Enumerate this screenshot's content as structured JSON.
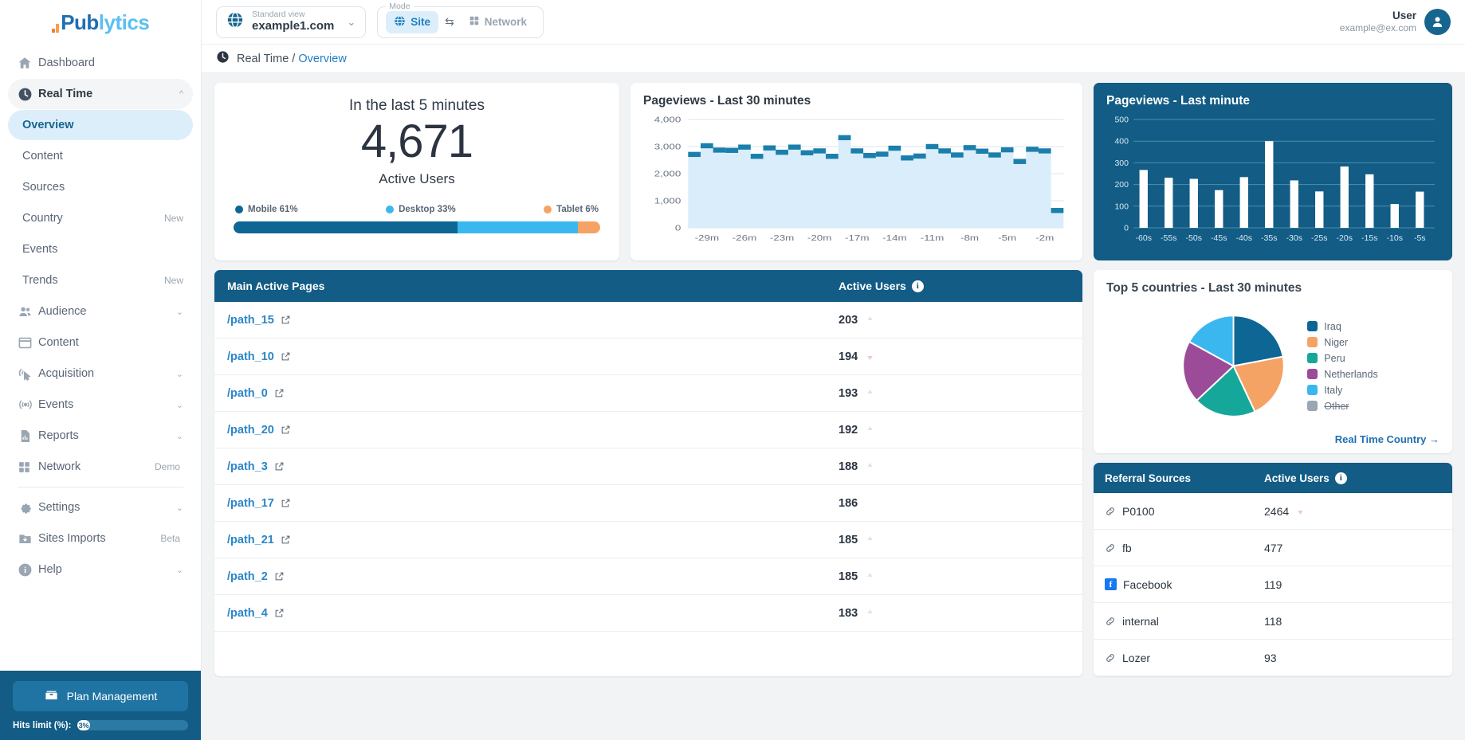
{
  "brand": {
    "name_part1": "Pub",
    "name_part2": "lytics"
  },
  "sidebar": {
    "items": [
      {
        "label": "Dashboard",
        "icon": "home-icon",
        "tag": "",
        "type": "item"
      },
      {
        "label": "Real Time",
        "icon": "clock-icon",
        "tag": "",
        "type": "parent-active"
      },
      {
        "label": "Overview",
        "tag": "",
        "type": "sub-selected"
      },
      {
        "label": "Content",
        "tag": "",
        "type": "sub"
      },
      {
        "label": "Sources",
        "tag": "",
        "type": "sub"
      },
      {
        "label": "Country",
        "tag": "New",
        "type": "sub"
      },
      {
        "label": "Events",
        "tag": "",
        "type": "sub"
      },
      {
        "label": "Trends",
        "tag": "New",
        "type": "sub"
      },
      {
        "label": "Audience",
        "icon": "people-icon",
        "tag": "",
        "type": "item-chev"
      },
      {
        "label": "Content",
        "icon": "window-icon",
        "tag": "",
        "type": "item"
      },
      {
        "label": "Acquisition",
        "icon": "click-icon",
        "tag": "",
        "type": "item-chev"
      },
      {
        "label": "Events",
        "icon": "broadcast-icon",
        "tag": "",
        "type": "item-chev"
      },
      {
        "label": "Reports",
        "icon": "report-icon",
        "tag": "",
        "type": "item-chev"
      },
      {
        "label": "Network",
        "icon": "grid-icon",
        "tag": "Demo",
        "type": "item"
      },
      {
        "label": "Settings",
        "icon": "gear-icon",
        "tag": "",
        "type": "item-chev"
      },
      {
        "label": "Sites Imports",
        "icon": "import-icon",
        "tag": "Beta",
        "type": "item"
      },
      {
        "label": "Help",
        "icon": "help-icon",
        "tag": "",
        "type": "item-chev"
      }
    ],
    "plan_button": "Plan Management",
    "hits_label": "Hits limit (%):",
    "hits_value": "3%",
    "hits_percent": 3
  },
  "topbar": {
    "view_label": "Standard view",
    "site": "example1.com",
    "mode_legend": "Mode",
    "mode_site": "Site",
    "mode_network": "Network",
    "user_name": "User",
    "user_email": "example@ex.com"
  },
  "breadcrumb": {
    "section": "Real Time / ",
    "current": "Overview"
  },
  "active_card": {
    "title": "In the last 5 minutes",
    "value": "4,671",
    "subtitle": "Active Users",
    "devices": [
      {
        "label": "Mobile 61%",
        "percent": 61,
        "color": "#0d6693"
      },
      {
        "label": "Desktop 33%",
        "percent": 33,
        "color": "#3bb7f0"
      },
      {
        "label": "Tablet 6%",
        "percent": 6,
        "color": "#f5a365"
      }
    ]
  },
  "tables": {
    "pages": {
      "header_col1": "Main Active Pages",
      "header_col2": "Active Users",
      "rows": [
        {
          "path": "/path_15",
          "users": "203",
          "trend": "up"
        },
        {
          "path": "/path_10",
          "users": "194",
          "trend": "down"
        },
        {
          "path": "/path_0",
          "users": "193",
          "trend": "up"
        },
        {
          "path": "/path_20",
          "users": "192",
          "trend": "up"
        },
        {
          "path": "/path_3",
          "users": "188",
          "trend": "up"
        },
        {
          "path": "/path_17",
          "users": "186",
          "trend": "none"
        },
        {
          "path": "/path_21",
          "users": "185",
          "trend": "up"
        },
        {
          "path": "/path_2",
          "users": "185",
          "trend": "up"
        },
        {
          "path": "/path_4",
          "users": "183",
          "trend": "up"
        }
      ]
    },
    "referral": {
      "header_col1": "Referral Sources",
      "header_col2": "Active Users",
      "rows": [
        {
          "name": "P0100",
          "users": "2464",
          "icon": "link-icon",
          "trend": "down"
        },
        {
          "name": "fb",
          "users": "477",
          "icon": "link-icon",
          "trend": "none"
        },
        {
          "name": "Facebook",
          "users": "119",
          "icon": "facebook-icon",
          "trend": "none"
        },
        {
          "name": "internal",
          "users": "118",
          "icon": "link-icon",
          "trend": "none"
        },
        {
          "name": "Lozer",
          "users": "93",
          "icon": "link-icon",
          "trend": "none"
        }
      ]
    }
  },
  "pie_card": {
    "title": "Top 5 countries - Last 30 minutes",
    "link": "Real Time Country",
    "link_arrow": "→"
  },
  "chart_data": [
    {
      "type": "area",
      "title": "Pageviews - Last 30 minutes",
      "xlabel": "",
      "ylabel": "",
      "ylim": [
        0,
        4000
      ],
      "yticks": [
        "0",
        "1,000",
        "2,000",
        "3,000",
        "4,000"
      ],
      "xticks": [
        "-29m",
        "-26m",
        "-23m",
        "-20m",
        "-17m",
        "-14m",
        "-11m",
        "-8m",
        "-5m",
        "-2m"
      ],
      "grid": true,
      "x": [
        "-30m",
        "-29m",
        "-28m",
        "-27m",
        "-26m",
        "-25m",
        "-24m",
        "-23m",
        "-22m",
        "-21m",
        "-20m",
        "-19m",
        "-18m",
        "-17m",
        "-16m",
        "-15m",
        "-14m",
        "-13m",
        "-12m",
        "-11m",
        "-10m",
        "-9m",
        "-8m",
        "-7m",
        "-6m",
        "-5m",
        "-4m",
        "-3m",
        "-2m",
        "-1m"
      ],
      "values": [
        2710,
        3030,
        2870,
        2860,
        2980,
        2640,
        2950,
        2790,
        2980,
        2770,
        2840,
        2640,
        3330,
        2840,
        2670,
        2720,
        2940,
        2580,
        2650,
        3000,
        2840,
        2690,
        2960,
        2830,
        2690,
        2880,
        2450,
        2900,
        2840,
        640
      ],
      "series_color": "#1b7fab",
      "fill_color": "#d9edfa"
    },
    {
      "type": "bar",
      "title": "Pageviews - Last minute",
      "xlabel": "",
      "ylabel": "",
      "ylim": [
        0,
        500
      ],
      "yticks": [
        "0",
        "100",
        "200",
        "300",
        "400",
        "500"
      ],
      "categories": [
        "-60s",
        "-55s",
        "-50s",
        "-45s",
        "-40s",
        "-35s",
        "-30s",
        "-25s",
        "-20s",
        "-15s",
        "-10s",
        "-5s"
      ],
      "values": [
        267,
        231,
        226,
        174,
        234,
        400,
        219,
        168,
        283,
        247,
        110,
        167
      ],
      "bar_color": "#ffffff",
      "background": "#125c85",
      "grid": true
    },
    {
      "type": "pie",
      "title": "Top 5 countries - Last 30 minutes",
      "labels": [
        "Iraq",
        "Niger",
        "Peru",
        "Netherlands",
        "Italy",
        "Other"
      ],
      "values": [
        22,
        21,
        20,
        20,
        17,
        0
      ],
      "colors": [
        "#0d6693",
        "#f5a365",
        "#16a79b",
        "#9c4b98",
        "#3bb7f0",
        "#9aa6b2"
      ],
      "disabled": [
        "Other"
      ],
      "legend_position": "right"
    }
  ]
}
